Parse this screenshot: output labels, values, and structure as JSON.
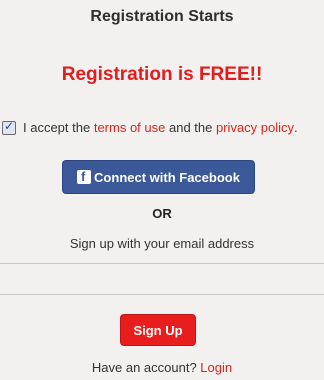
{
  "header": {
    "title": "Registration Starts"
  },
  "promo": {
    "text": "Registration is FREE!!"
  },
  "terms": {
    "checked": true,
    "prefix": "I accept the ",
    "terms_link": "terms of use",
    "middle": " and the ",
    "privacy_link": "privacy policy",
    "suffix": "."
  },
  "facebook": {
    "label": "Connect with Facebook"
  },
  "divider": {
    "text": "OR"
  },
  "email_section": {
    "prompt": "Sign up with your email address",
    "input_placeholder": ""
  },
  "signup": {
    "label": "Sign Up"
  },
  "login": {
    "prompt": "Have an account? ",
    "link": "Login"
  },
  "colors": {
    "accent_red": "#e31d1d",
    "facebook_blue": "#3b5998",
    "background": "#f2f1ef"
  }
}
